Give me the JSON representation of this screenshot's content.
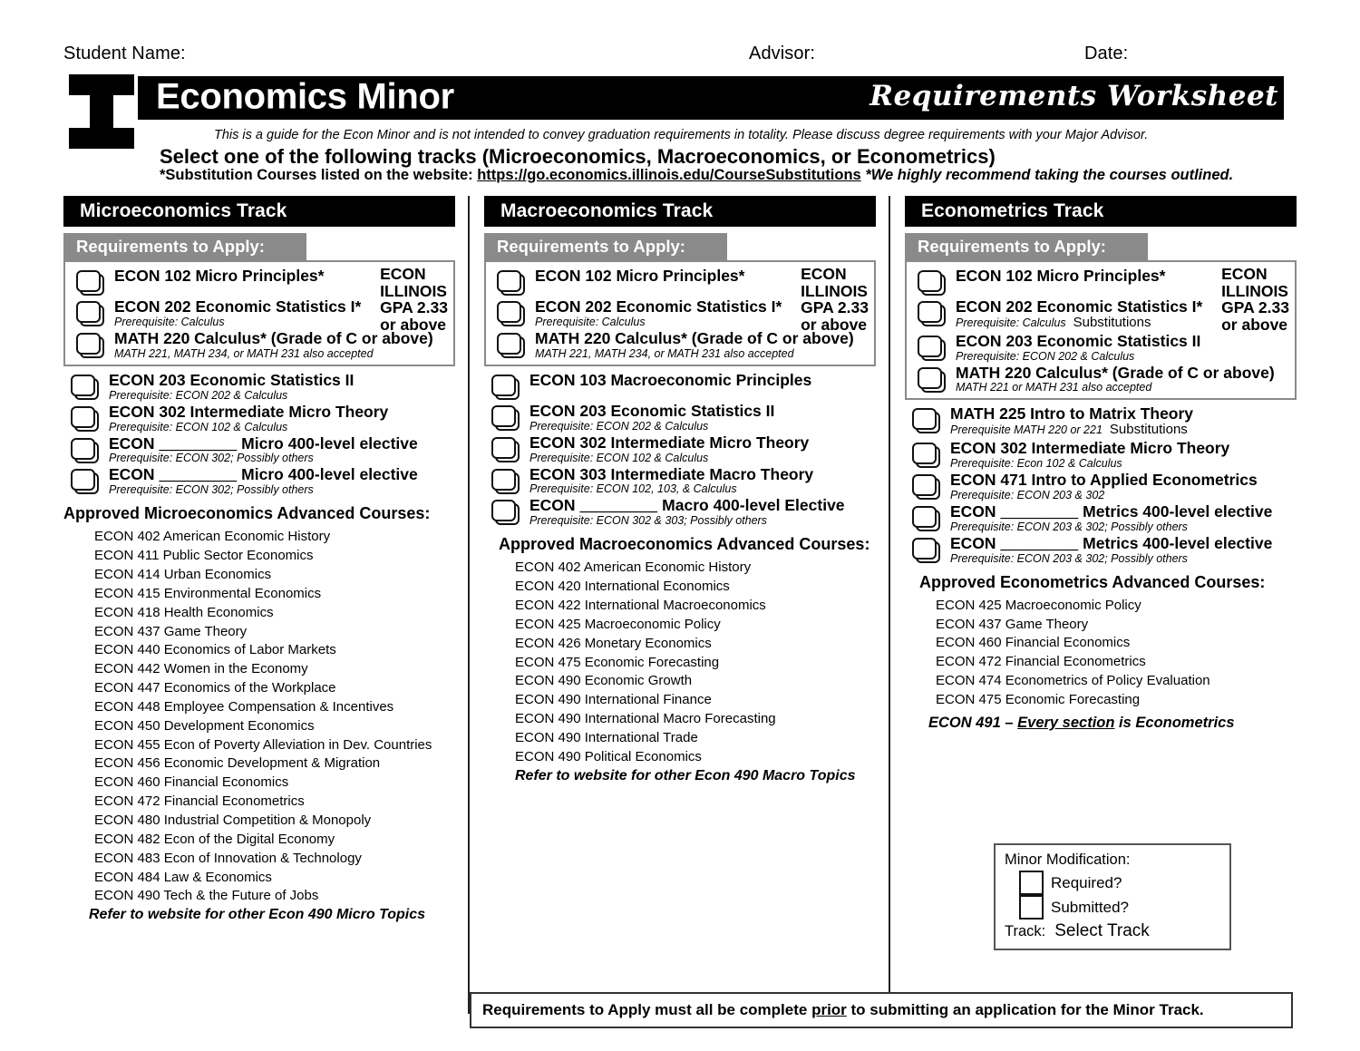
{
  "top_fields": {
    "student_name_label": "Student Name:",
    "advisor_label": "Advisor:",
    "date_label": "Date:"
  },
  "masthead": {
    "title": "Economics Minor",
    "script_label": "Requirements Worksheet",
    "logo_icon": "block-i-logo-icon"
  },
  "intro": {
    "guide_note": "This is a guide for the Econ Minor and is not intended to convey graduation requirements in totality. Please discuss degree requirements with your Major Advisor.",
    "select_tracks": "Select one of the following tracks (Microeconomics, Macroeconomics, or Econometrics)",
    "substitution_prefix": "*Substitution Courses listed on the website: ",
    "substitution_url": "https://go.economics.illinois.edu/CourseSubstitutions",
    "recommend_note": "*We highly recommend taking the courses outlined."
  },
  "gpa_note": {
    "line1": "ECON",
    "line2": "ILLINOIS",
    "line3": "GPA 2.33",
    "line4": "or above"
  },
  "requirements_banner": "Requirements to Apply:",
  "tracks": {
    "micro": {
      "header": "Microeconomics Track",
      "apply_courses": [
        {
          "name": "ECON 102 Micro Principles*",
          "prereq": ""
        },
        {
          "name": "ECON 202 Economic Statistics I*",
          "prereq": "Prerequisite: Calculus"
        },
        {
          "name": "MATH 220 Calculus* (Grade of C or above)",
          "prereq": "MATH 221, MATH 234, or MATH 231 also accepted"
        }
      ],
      "other_courses": [
        {
          "name": "ECON 203 Economic Statistics II",
          "prereq": "Prerequisite: ECON 202 & Calculus"
        },
        {
          "name": "ECON 302 Intermediate Micro Theory",
          "prereq": "Prerequisite: ECON 102 & Calculus"
        },
        {
          "name_pre": "ECON ",
          "name_blank": "________",
          "name_post": " Micro 400-level elective",
          "prereq": "Prerequisite: ECON 302; Possibly others"
        },
        {
          "name_pre": "ECON ",
          "name_blank": "________",
          "name_post": " Micro 400-level elective",
          "prereq": "Prerequisite: ECON 302; Possibly others"
        }
      ],
      "approved_heading": "Approved Microeconomics Advanced Courses:",
      "approved_courses": [
        "ECON 402  American Economic History",
        "ECON 411 Public Sector Economics",
        "ECON 414 Urban Economics",
        "ECON 415 Environmental Economics",
        "ECON 418 Health Economics",
        "ECON 437 Game Theory",
        "ECON 440 Economics of Labor Markets",
        "ECON 442 Women in the Economy",
        "ECON 447 Economics of the Workplace",
        "ECON 448 Employee Compensation & Incentives",
        "ECON 450 Development Economics",
        "ECON 455 Econ of Poverty Alleviation in Dev. Countries",
        "ECON 456 Economic Development & Migration",
        "ECON 460 Financial Economics",
        "ECON 472 Financial Econometrics",
        "ECON 480 Industrial Competition & Monopoly",
        "ECON 482 Econ of the Digital Economy",
        "ECON 483 Econ of Innovation & Technology",
        "ECON 484 Law & Economics",
        "ECON 490 Tech & the Future of Jobs"
      ],
      "refer_note": "Refer to website for other Econ 490 Micro Topics"
    },
    "macro": {
      "header": "Macroeconomics Track",
      "apply_courses": [
        {
          "name": "ECON 102 Micro Principles*",
          "prereq": ""
        },
        {
          "name": "ECON 202 Economic Statistics I*",
          "prereq": "Prerequisite: Calculus"
        },
        {
          "name": "MATH 220 Calculus* (Grade of C or above)",
          "prereq": "MATH 221, MATH 234, or MATH 231 also accepted"
        }
      ],
      "other_courses": [
        {
          "name": "ECON 103 Macroeconomic Principles",
          "prereq": ""
        },
        {
          "name": "ECON 203 Economic Statistics II",
          "prereq": "Prerequisite: ECON 202 & Calculus"
        },
        {
          "name": "ECON 302 Intermediate Micro Theory",
          "prereq": "Prerequisite: ECON 102 & Calculus"
        },
        {
          "name": "ECON 303 Intermediate Macro Theory",
          "prereq": "Prerequisite: ECON 102, 103, & Calculus"
        },
        {
          "name_pre": "ECON ",
          "name_blank": "________",
          "name_post": " Macro 400-level Elective",
          "prereq": "Prerequisite: ECON 302 & 303; Possibly others"
        }
      ],
      "approved_heading": "Approved Macroeconomics Advanced Courses:",
      "approved_courses": [
        "ECON 402 American Economic History",
        "ECON 420 International Economics",
        "ECON 422 International Macroeconomics",
        "ECON 425 Macroeconomic Policy",
        "ECON 426 Monetary Economics",
        "ECON 475 Economic Forecasting",
        "ECON 490 Economic Growth",
        "ECON 490 International Finance",
        "ECON 490 International Macro Forecasting",
        "ECON 490 International Trade",
        "ECON 490 Political Economics"
      ],
      "refer_note": "Refer to website for other Econ 490 Macro Topics"
    },
    "metrics": {
      "header": "Econometrics Track",
      "apply_courses": [
        {
          "name": "ECON 102 Micro Principles*",
          "prereq": ""
        },
        {
          "name": "ECON 202 Economic Statistics I*",
          "prereq": "Prerequisite: Calculus",
          "prereq_extra": "Substitutions"
        },
        {
          "name": "ECON 203 Economic Statistics II",
          "prereq": "Prerequisite: ECON 202 & Calculus"
        },
        {
          "name": "MATH 220 Calculus* (Grade of C or above)",
          "prereq": "MATH 221 or MATH 231 also accepted"
        }
      ],
      "other_courses": [
        {
          "name": "MATH 225 Intro to Matrix Theory",
          "prereq": "Prerequisite MATH 220 or 221",
          "prereq_extra": "Substitutions"
        },
        {
          "name": "ECON 302 Intermediate Micro Theory",
          "prereq": "Prerequisite: Econ 102 & Calculus"
        },
        {
          "name": "ECON 471 Intro to Applied Econometrics",
          "prereq": "Prerequisite: ECON 203 & 302"
        },
        {
          "name_pre": "ECON ",
          "name_blank": "________",
          "name_post": " Metrics 400-level elective",
          "prereq": "Prerequisite: ECON 203 & 302; Possibly others"
        },
        {
          "name_pre": "ECON ",
          "name_blank": "________",
          "name_post": " Metrics 400-level elective",
          "prereq": "Prerequisite: ECON 203 & 302; Possibly others"
        }
      ],
      "approved_heading": "Approved Econometrics Advanced Courses:",
      "approved_courses": [
        "ECON 425 Macroeconomic Policy",
        "ECON 437 Game Theory",
        "ECON 460 Financial Economics",
        "ECON 472 Financial Econometrics",
        "ECON 474 Econometrics of Policy Evaluation",
        "ECON 475 Economic Forecasting"
      ],
      "econ491_pre": "ECON 491 – ",
      "econ491_underline": "Every section",
      "econ491_post": " is Econometrics"
    }
  },
  "minor_modification": {
    "title": "Minor Modification:",
    "required_label": "Required?",
    "submitted_label": "Submitted?",
    "track_label": "Track:",
    "track_value": "Select Track"
  },
  "footer": {
    "pre": "Requirements to Apply must all be complete ",
    "underlined": "prior",
    "post": " to submitting an application for the Minor Track."
  },
  "colors": {
    "black": "#000000",
    "banner_gray": "#8a8a8a",
    "box_border_gray": "#8a8a8a"
  }
}
